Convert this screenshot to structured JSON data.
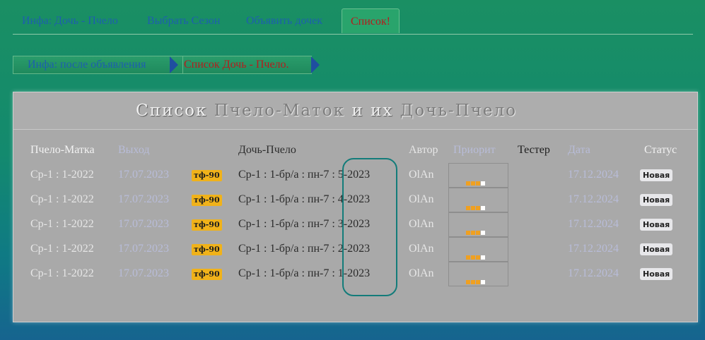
{
  "nav_tabs": [
    {
      "label": "Инфа: Дочь - Пчело",
      "active": false
    },
    {
      "label": "Выбрать Сезон",
      "active": false
    },
    {
      "label": "Объявить дочек",
      "active": false
    },
    {
      "label": "Список!",
      "active": true
    }
  ],
  "breadcrumbs": [
    {
      "label": "Инфа: после объявления"
    },
    {
      "label": "Список Дочь - Пчело."
    }
  ],
  "panel": {
    "title_part1": "Список",
    "title_part2": "Пчело-Маток",
    "title_part3": "и их",
    "title_part4": "Дочь-Пчело"
  },
  "table": {
    "headers": {
      "matka": "Пчело-Матка",
      "vyhod": "Выход",
      "doch": "Дочь-Пчело",
      "avtor": "Автор",
      "prior": "Приорит",
      "tester": "Тестер",
      "data": "Дата",
      "status": "Статус"
    },
    "rows": [
      {
        "matka": "Ср-1 : 1-2022",
        "vyhod": "17.07.2023",
        "badge": "тф-90",
        "doch": "Ср-1 : 1-бр/а : пн-7 : 5-2023",
        "avtor": "OlAn",
        "priority": 3,
        "tester": "",
        "data": "17.12.2024",
        "status": "Новая"
      },
      {
        "matka": "Ср-1 : 1-2022",
        "vyhod": "17.07.2023",
        "badge": "тф-90",
        "doch": "Ср-1 : 1-бр/а : пн-7 : 4-2023",
        "avtor": "OlAn",
        "priority": 3,
        "tester": "",
        "data": "17.12.2024",
        "status": "Новая"
      },
      {
        "matka": "Ср-1 : 1-2022",
        "vyhod": "17.07.2023",
        "badge": "тф-90",
        "doch": "Ср-1 : 1-бр/а : пн-7 : 3-2023",
        "avtor": "OlAn",
        "priority": 3,
        "tester": "",
        "data": "17.12.2024",
        "status": "Новая"
      },
      {
        "matka": "Ср-1 : 1-2022",
        "vyhod": "17.07.2023",
        "badge": "тф-90",
        "doch": "Ср-1 : 1-бр/а : пн-7 : 2-2023",
        "avtor": "OlAn",
        "priority": 3,
        "tester": "",
        "data": "17.12.2024",
        "status": "Новая"
      },
      {
        "matka": "Ср-1 : 1-2022",
        "vyhod": "17.07.2023",
        "badge": "тф-90",
        "doch": "Ср-1 : 1-бр/а : пн-7 : 1-2023",
        "avtor": "OlAn",
        "priority": 3,
        "tester": "",
        "data": "17.12.2024",
        "status": "Новая"
      }
    ]
  },
  "colors": {
    "active_tab_text": "#b51d1d",
    "tab_text": "#1d5fae",
    "badge_bg": "#f0b21a",
    "priority_dot": "#f0a020",
    "highlight_border": "#137c7a"
  }
}
